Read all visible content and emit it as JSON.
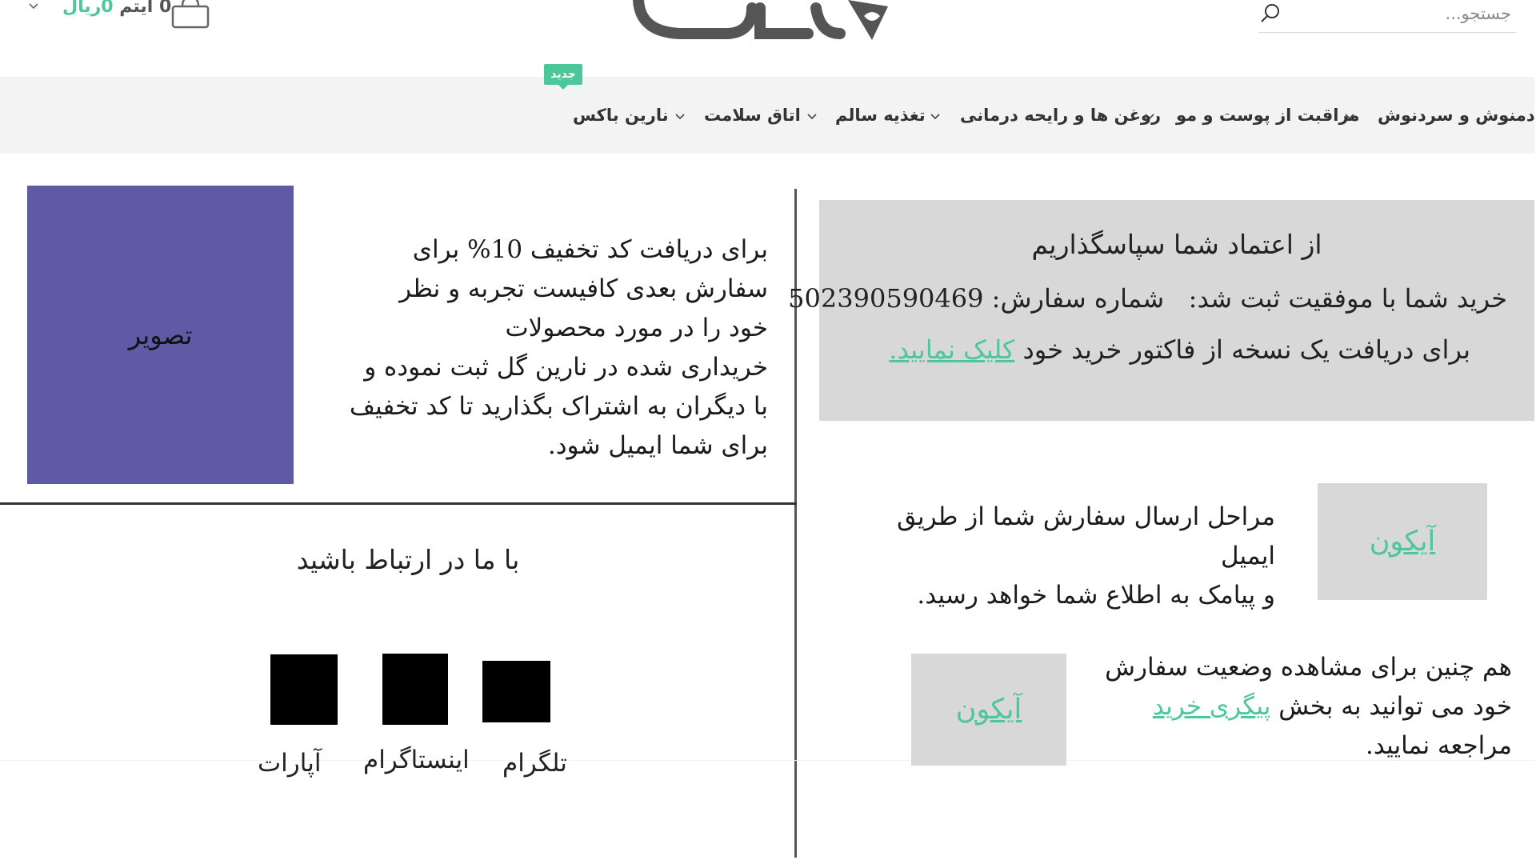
{
  "header": {
    "search_placeholder": "جستجو...",
    "logo_alt": "نارین گل",
    "cart": {
      "count_label": "0 آیتم",
      "price_label": "0ریال"
    }
  },
  "nav": {
    "badge": "جدید",
    "items": [
      {
        "label": "دمنوش و سردنوش"
      },
      {
        "label": "مراقبت از پوست و مو"
      },
      {
        "label": "روغن ها و رایحه درمانی"
      },
      {
        "label": "تغذیه سالم"
      },
      {
        "label": "اتاق سلامت"
      },
      {
        "label": "نارین باکس"
      }
    ]
  },
  "thanks": {
    "title": "از اعتماد شما سپاسگذاریم",
    "success_text": "خرید شما با موفقیت ثبت شد:",
    "order_label": "شماره سفارش:",
    "order_number": "502390590469",
    "invoice_prefix": "برای دریافت یک نسخه از فاکتور خرید خود",
    "invoice_link": "کلیک نمایید."
  },
  "discount": {
    "image_label": "تصویر",
    "lines": [
      "برای دریافت کد تخفیف 10% برای",
      "سفارش بعدی کافیست تجربه و نظر",
      "خود را در مورد محصولات",
      "خریداری شده در نارین گل ثبت نموده و",
      "با دیگران به اشتراک بگذارید تا کد تخفیف",
      "برای شما ایمیل شود."
    ]
  },
  "steps": {
    "icon_label": "آیکون",
    "lines": [
      "مراحل ارسال سفارش شما از طریق ایمیل",
      "و پیامک به اطلاع شما خواهد رسید."
    ]
  },
  "tracking": {
    "icon_label": "آیکون",
    "line1": "هم چنین برای مشاهده وضعیت سفارش",
    "line2_prefix": "خود می توانید به بخش",
    "link": "پیگری خرید",
    "line3": "مراجعه نمایید."
  },
  "contact": {
    "title": "با ما در ارتباط باشید",
    "socials": [
      {
        "label": "تلگرام"
      },
      {
        "label": "اینستاگرام"
      },
      {
        "label": "آپارات"
      }
    ]
  },
  "colors": {
    "accent": "#4cc79a",
    "image_placeholder": "#5e5aa6",
    "box_gray": "#d8d8d8",
    "nav_bg": "#f3f3f3"
  }
}
